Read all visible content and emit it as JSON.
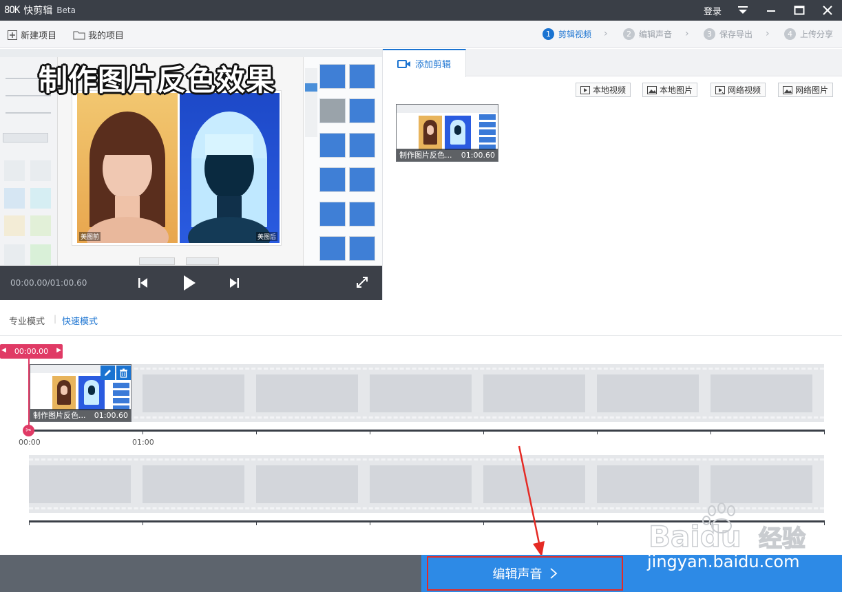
{
  "app": {
    "brand_mark": "8OK",
    "name": "快剪辑",
    "edition": "Beta",
    "login": "登录"
  },
  "toolbar": {
    "new_project": "新建项目",
    "my_projects": "我的项目"
  },
  "steps": [
    {
      "num": "1",
      "label": "剪辑视频"
    },
    {
      "num": "2",
      "label": "编辑声音"
    },
    {
      "num": "3",
      "label": "保存导出"
    },
    {
      "num": "4",
      "label": "上传分享"
    }
  ],
  "preview": {
    "overlay_title": "制作图片反色效果",
    "before_label": "美图前",
    "after_label": "美图后",
    "time": "00:00.00/01:00.60"
  },
  "clip_panel": {
    "tab_label": "添加剪辑",
    "sources": [
      "本地视频",
      "本地图片",
      "网络视频",
      "网络图片"
    ],
    "clip": {
      "name": "制作图片反色...",
      "duration": "01:00.60"
    }
  },
  "modes": {
    "pro": "专业模式",
    "quick": "快速模式"
  },
  "timeline": {
    "playhead_time": "00:00.00",
    "clip": {
      "name": "制作图片反色...",
      "duration": "01:00.60"
    },
    "tick_labels": [
      "00:00",
      "01:00"
    ]
  },
  "footer": {
    "next_button": "编辑声音",
    "watermark_url": "jingyan.baidu.com",
    "watermark_brand": "Baidu",
    "watermark_word": "经验"
  },
  "colors": {
    "accent": "#1a73d1",
    "playhead": "#e03a65",
    "highlight_box": "#e52a24",
    "footer_blue": "#2d8ae6"
  }
}
